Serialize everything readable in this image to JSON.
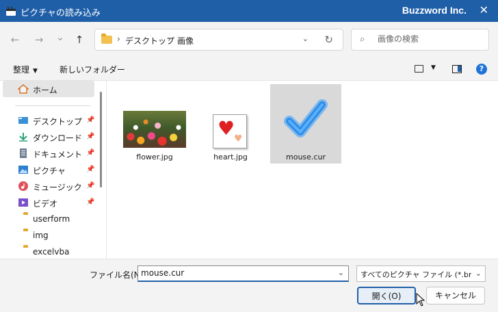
{
  "window": {
    "title": "ピクチャの読み込み",
    "brand": "Buzzword Inc.",
    "close_glyph": "✕"
  },
  "navigation": {
    "back_glyph": "←",
    "forward_glyph": "→",
    "history_glyph": "⌄",
    "up_glyph": "↑"
  },
  "address": {
    "separator": "›",
    "segments": [
      "デスクトップ",
      "画像"
    ],
    "dropdown_glyph": "⌄",
    "refresh_glyph": "↻"
  },
  "search": {
    "placeholder": "画像の検索",
    "icon_glyph": "⌕"
  },
  "toolbar": {
    "organize_label": "整理",
    "caret_glyph": "▼",
    "new_folder_label": "新しいフォルダー",
    "help_glyph": "?"
  },
  "sidebar": {
    "home_label": "ホーム",
    "pin_glyph": "📌",
    "items": [
      {
        "label": "デスクトップ",
        "icon": "desktop-icon",
        "pinned": true
      },
      {
        "label": "ダウンロード",
        "icon": "download-icon",
        "pinned": true
      },
      {
        "label": "ドキュメント",
        "icon": "document-icon",
        "pinned": true
      },
      {
        "label": "ピクチャ",
        "icon": "pictures-icon",
        "pinned": true
      },
      {
        "label": "ミュージック",
        "icon": "music-icon",
        "pinned": true
      },
      {
        "label": "ビデオ",
        "icon": "video-icon",
        "pinned": true
      },
      {
        "label": "userform",
        "icon": "folder-icon",
        "pinned": false
      },
      {
        "label": "img",
        "icon": "folder-icon",
        "pinned": false
      },
      {
        "label": "excelvba",
        "icon": "folder-icon",
        "pinned": false
      }
    ]
  },
  "files": [
    {
      "name": "flower.jpg",
      "selected": false
    },
    {
      "name": "heart.jpg",
      "selected": false
    },
    {
      "name": "mouse.cur",
      "selected": true
    }
  ],
  "footer": {
    "filename_label": "ファイル名(N):",
    "filename_value": "mouse.cur",
    "filename_dropdown_glyph": "⌄",
    "filter_value": "すべてのピクチャ ファイル (*.bmp;*.gif",
    "filter_dropdown_glyph": "⌄",
    "open_label": "開く(O)",
    "cancel_label": "キャンセル"
  },
  "colors": {
    "titlebar": "#1f5fa8",
    "accent": "#1f73d8",
    "selection": "#d9d9d9",
    "folder": "#f2c14e"
  }
}
